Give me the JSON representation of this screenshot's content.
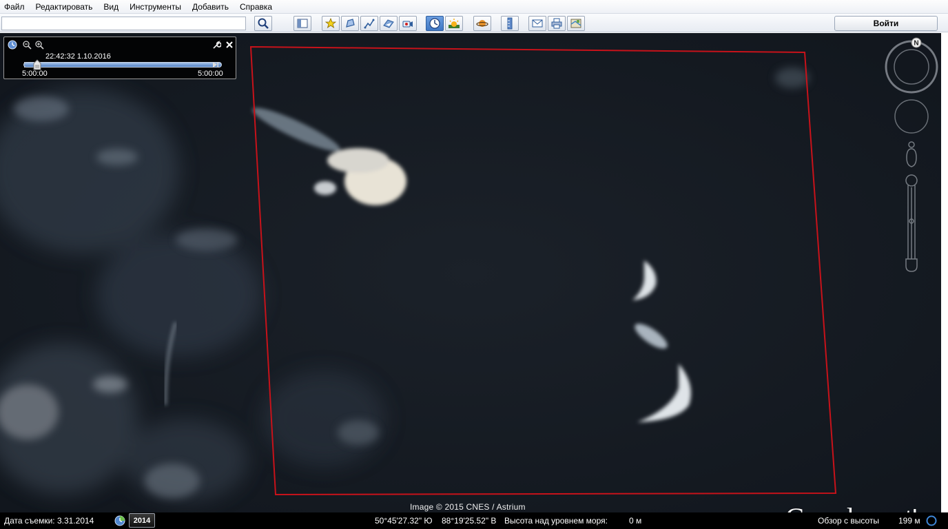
{
  "menu": {
    "items": [
      "Файл",
      "Редактировать",
      "Вид",
      "Инструменты",
      "Добавить",
      "Справка"
    ]
  },
  "toolbar": {
    "search_value": "",
    "login_label": "Войти",
    "buttons": [
      {
        "name": "search-button",
        "icon": "magnifier-icon"
      },
      {
        "name": "sidebar-toggle-button",
        "icon": "sidebar-icon"
      },
      {
        "name": "add-placemark-button",
        "icon": "pushpin-star-icon"
      },
      {
        "name": "add-polygon-button",
        "icon": "polygon-icon"
      },
      {
        "name": "add-path-button",
        "icon": "path-icon"
      },
      {
        "name": "add-image-overlay-button",
        "icon": "image-overlay-icon"
      },
      {
        "name": "record-tour-button",
        "icon": "record-tour-icon"
      },
      {
        "name": "historical-imagery-button",
        "icon": "clock-icon",
        "active": true
      },
      {
        "name": "sunlight-button",
        "icon": "sun-icon"
      },
      {
        "name": "switch-planet-button",
        "icon": "planet-icon"
      },
      {
        "name": "ruler-button",
        "icon": "ruler-icon"
      },
      {
        "name": "email-button",
        "icon": "envelope-icon"
      },
      {
        "name": "print-button",
        "icon": "printer-icon"
      },
      {
        "name": "view-in-maps-button",
        "icon": "map-icon"
      }
    ]
  },
  "time_slider": {
    "current": "22:42:32 1.10.2016",
    "start": "5:00:00",
    "end": "5:00:00",
    "position": 0.07
  },
  "compass": {
    "north_label": "N"
  },
  "map": {
    "attribution": "Image © 2015 CNES / Astrium",
    "logo_google": "Google",
    "logo_earth": "earth",
    "outline_color": "#c8121a"
  },
  "status": {
    "capture_date": "Дата съемки: 3.31.2014",
    "year": "2014",
    "latitude": "50°45'27.32\" Ю",
    "longitude": "88°19'25.52\" В",
    "elevation_label": "Высота над уровнем моря:",
    "elevation_value": "0 м",
    "eye_alt_label": "Обзор с высоты",
    "eye_alt_value": "199 м"
  }
}
